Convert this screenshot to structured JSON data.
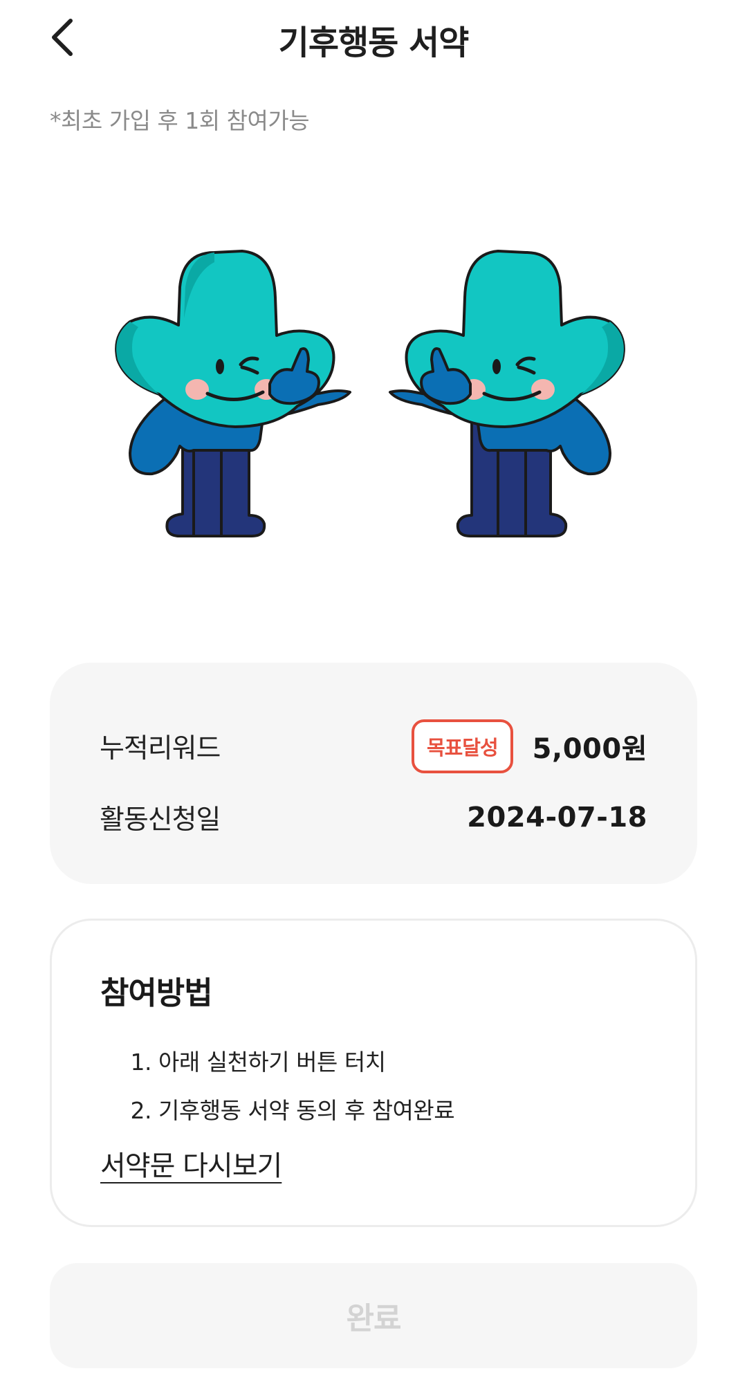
{
  "header": {
    "title": "기후행동 서약",
    "back_icon": "chevron-left-icon"
  },
  "notice": "*최초 가입 후 1회 참여가능",
  "illustration": {
    "description_icon": "mascot-characters-thumbs-up"
  },
  "reward_summary": {
    "accumulated_label": "누적리워드",
    "badge": "목표달성",
    "accumulated_value": "5,000원",
    "apply_date_label": "활동신청일",
    "apply_date_value": "2024-07-18"
  },
  "method": {
    "title": "참여방법",
    "steps": [
      {
        "num": "1.",
        "text": "아래 실천하기 버튼 터치"
      },
      {
        "num": "2.",
        "text": "기후행동 서약 동의 후 참여완료"
      }
    ],
    "reread_link": "서약문 다시보기"
  },
  "footer": {
    "complete_button": "완료"
  },
  "colors": {
    "accent_red": "#e8513f",
    "mascot_head": "#12c6c2",
    "mascot_body": "#0b6fb4",
    "mascot_legs": "#23357a",
    "card_bg": "#f6f6f6"
  }
}
